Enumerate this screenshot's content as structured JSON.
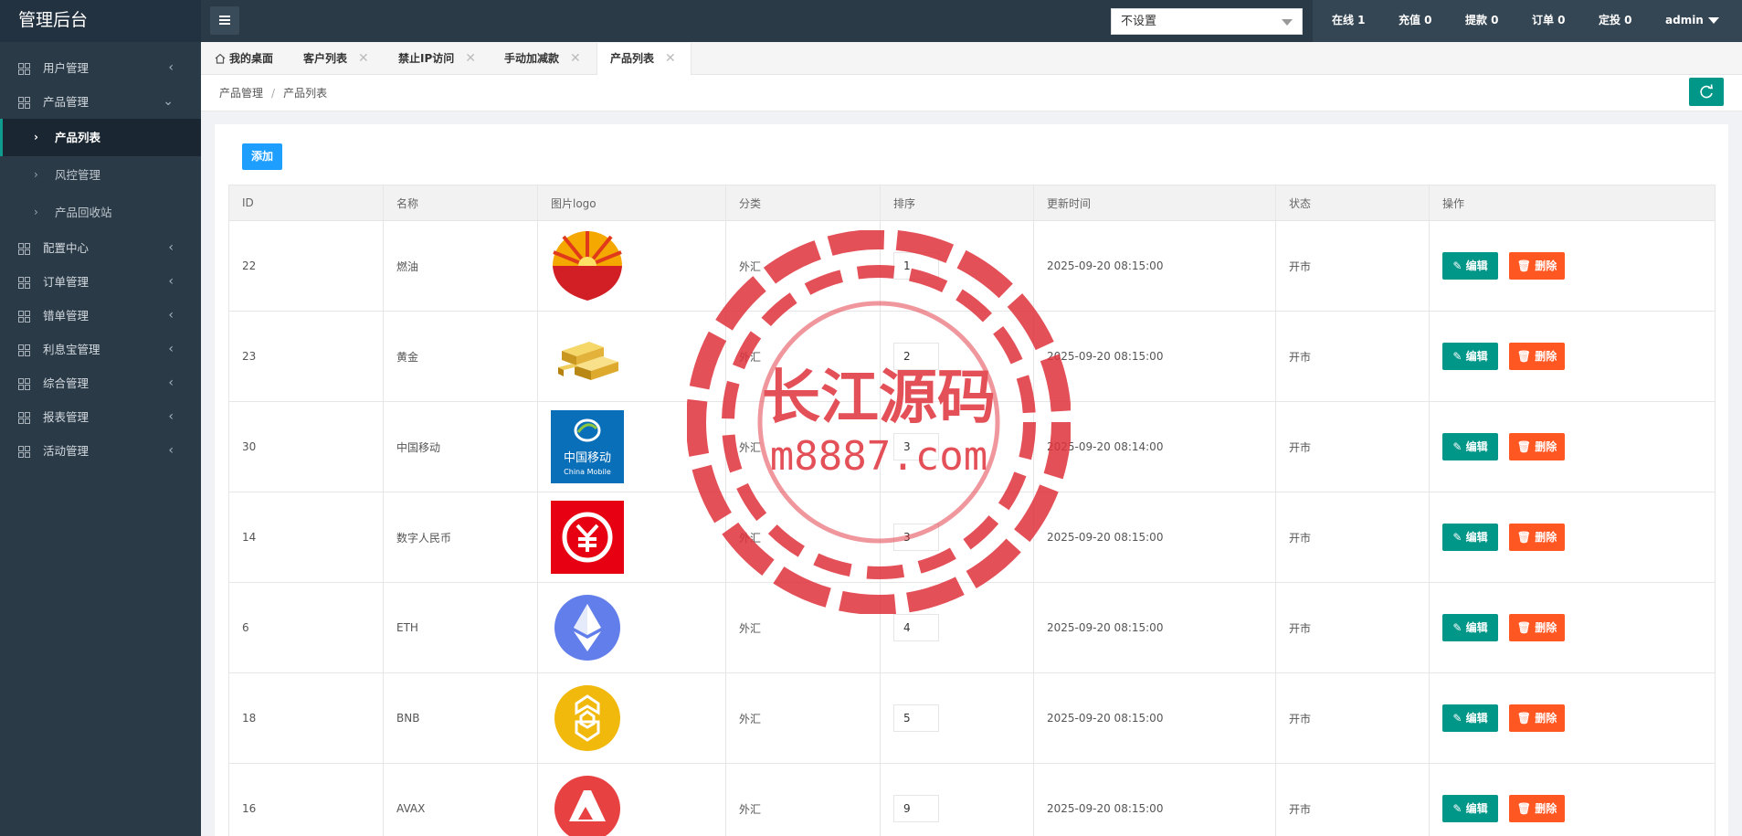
{
  "sidebar": {
    "title": "管理后台",
    "menu": [
      {
        "label": "用户管理",
        "arrow": "‹"
      },
      {
        "label": "产品管理",
        "arrow": "⌄"
      }
    ],
    "submenu": [
      {
        "label": "产品列表"
      },
      {
        "label": "风控管理"
      },
      {
        "label": "产品回收站"
      }
    ],
    "menu2": [
      {
        "label": "配置中心"
      },
      {
        "label": "订单管理"
      },
      {
        "label": "错单管理"
      },
      {
        "label": "利息宝管理"
      },
      {
        "label": "综合管理"
      },
      {
        "label": "报表管理"
      },
      {
        "label": "活动管理"
      }
    ]
  },
  "topbar": {
    "select_value": "不设置",
    "stats": [
      "在线 1",
      "充值 0",
      "提款 0",
      "订单 0",
      "定投 0"
    ],
    "user": "admin"
  },
  "tabs": [
    {
      "label": "我的桌面"
    },
    {
      "label": "客户列表"
    },
    {
      "label": "禁止IP访问"
    },
    {
      "label": "手动加减款"
    },
    {
      "label": "产品列表"
    }
  ],
  "breadcrumb": [
    "产品管理",
    "产品列表"
  ],
  "toolbar": {
    "add_label": "添加"
  },
  "table": {
    "headers": [
      "ID",
      "名称",
      "图片logo",
      "分类",
      "排序",
      "更新时间",
      "状态",
      "操作"
    ],
    "rows": [
      {
        "id": "22",
        "name": "燃油",
        "logo": "petrochina-logo",
        "category": "外汇",
        "sort": "1",
        "updated": "2025-09-20 08:15:00",
        "status": "开市"
      },
      {
        "id": "23",
        "name": "黄金",
        "logo": "gold-bars-logo",
        "category": "外汇",
        "sort": "2",
        "updated": "2025-09-20 08:15:00",
        "status": "开市"
      },
      {
        "id": "30",
        "name": "中国移动",
        "logo": "china-mobile-logo",
        "category": "外汇",
        "sort": "3",
        "updated": "2025-09-20 08:14:00",
        "status": "开市"
      },
      {
        "id": "14",
        "name": "数字人民币",
        "logo": "digital-rmb-logo",
        "category": "外汇",
        "sort": "3",
        "updated": "2025-09-20 08:15:00",
        "status": "开市"
      },
      {
        "id": "6",
        "name": "ETH",
        "logo": "eth-logo",
        "category": "外汇",
        "sort": "4",
        "updated": "2025-09-20 08:15:00",
        "status": "开市"
      },
      {
        "id": "18",
        "name": "BNB",
        "logo": "bnb-logo",
        "category": "外汇",
        "sort": "5",
        "updated": "2025-09-20 08:15:00",
        "status": "开市"
      },
      {
        "id": "16",
        "name": "AVAX",
        "logo": "avax-logo",
        "category": "外汇",
        "sort": "9",
        "updated": "2025-09-20 08:15:00",
        "status": "开市"
      }
    ],
    "edit_label": "编辑",
    "delete_label": "删除"
  },
  "logo_text": {
    "china_mobile": "中国移动",
    "china_mobile_en": "China Mobile"
  },
  "watermark": {
    "title": "长江源码",
    "url": "m8887.com"
  },
  "colors": {
    "sidebar": "#2a3a47",
    "accent": "#009688",
    "danger": "#ff5722",
    "primary": "#1e9fff"
  }
}
